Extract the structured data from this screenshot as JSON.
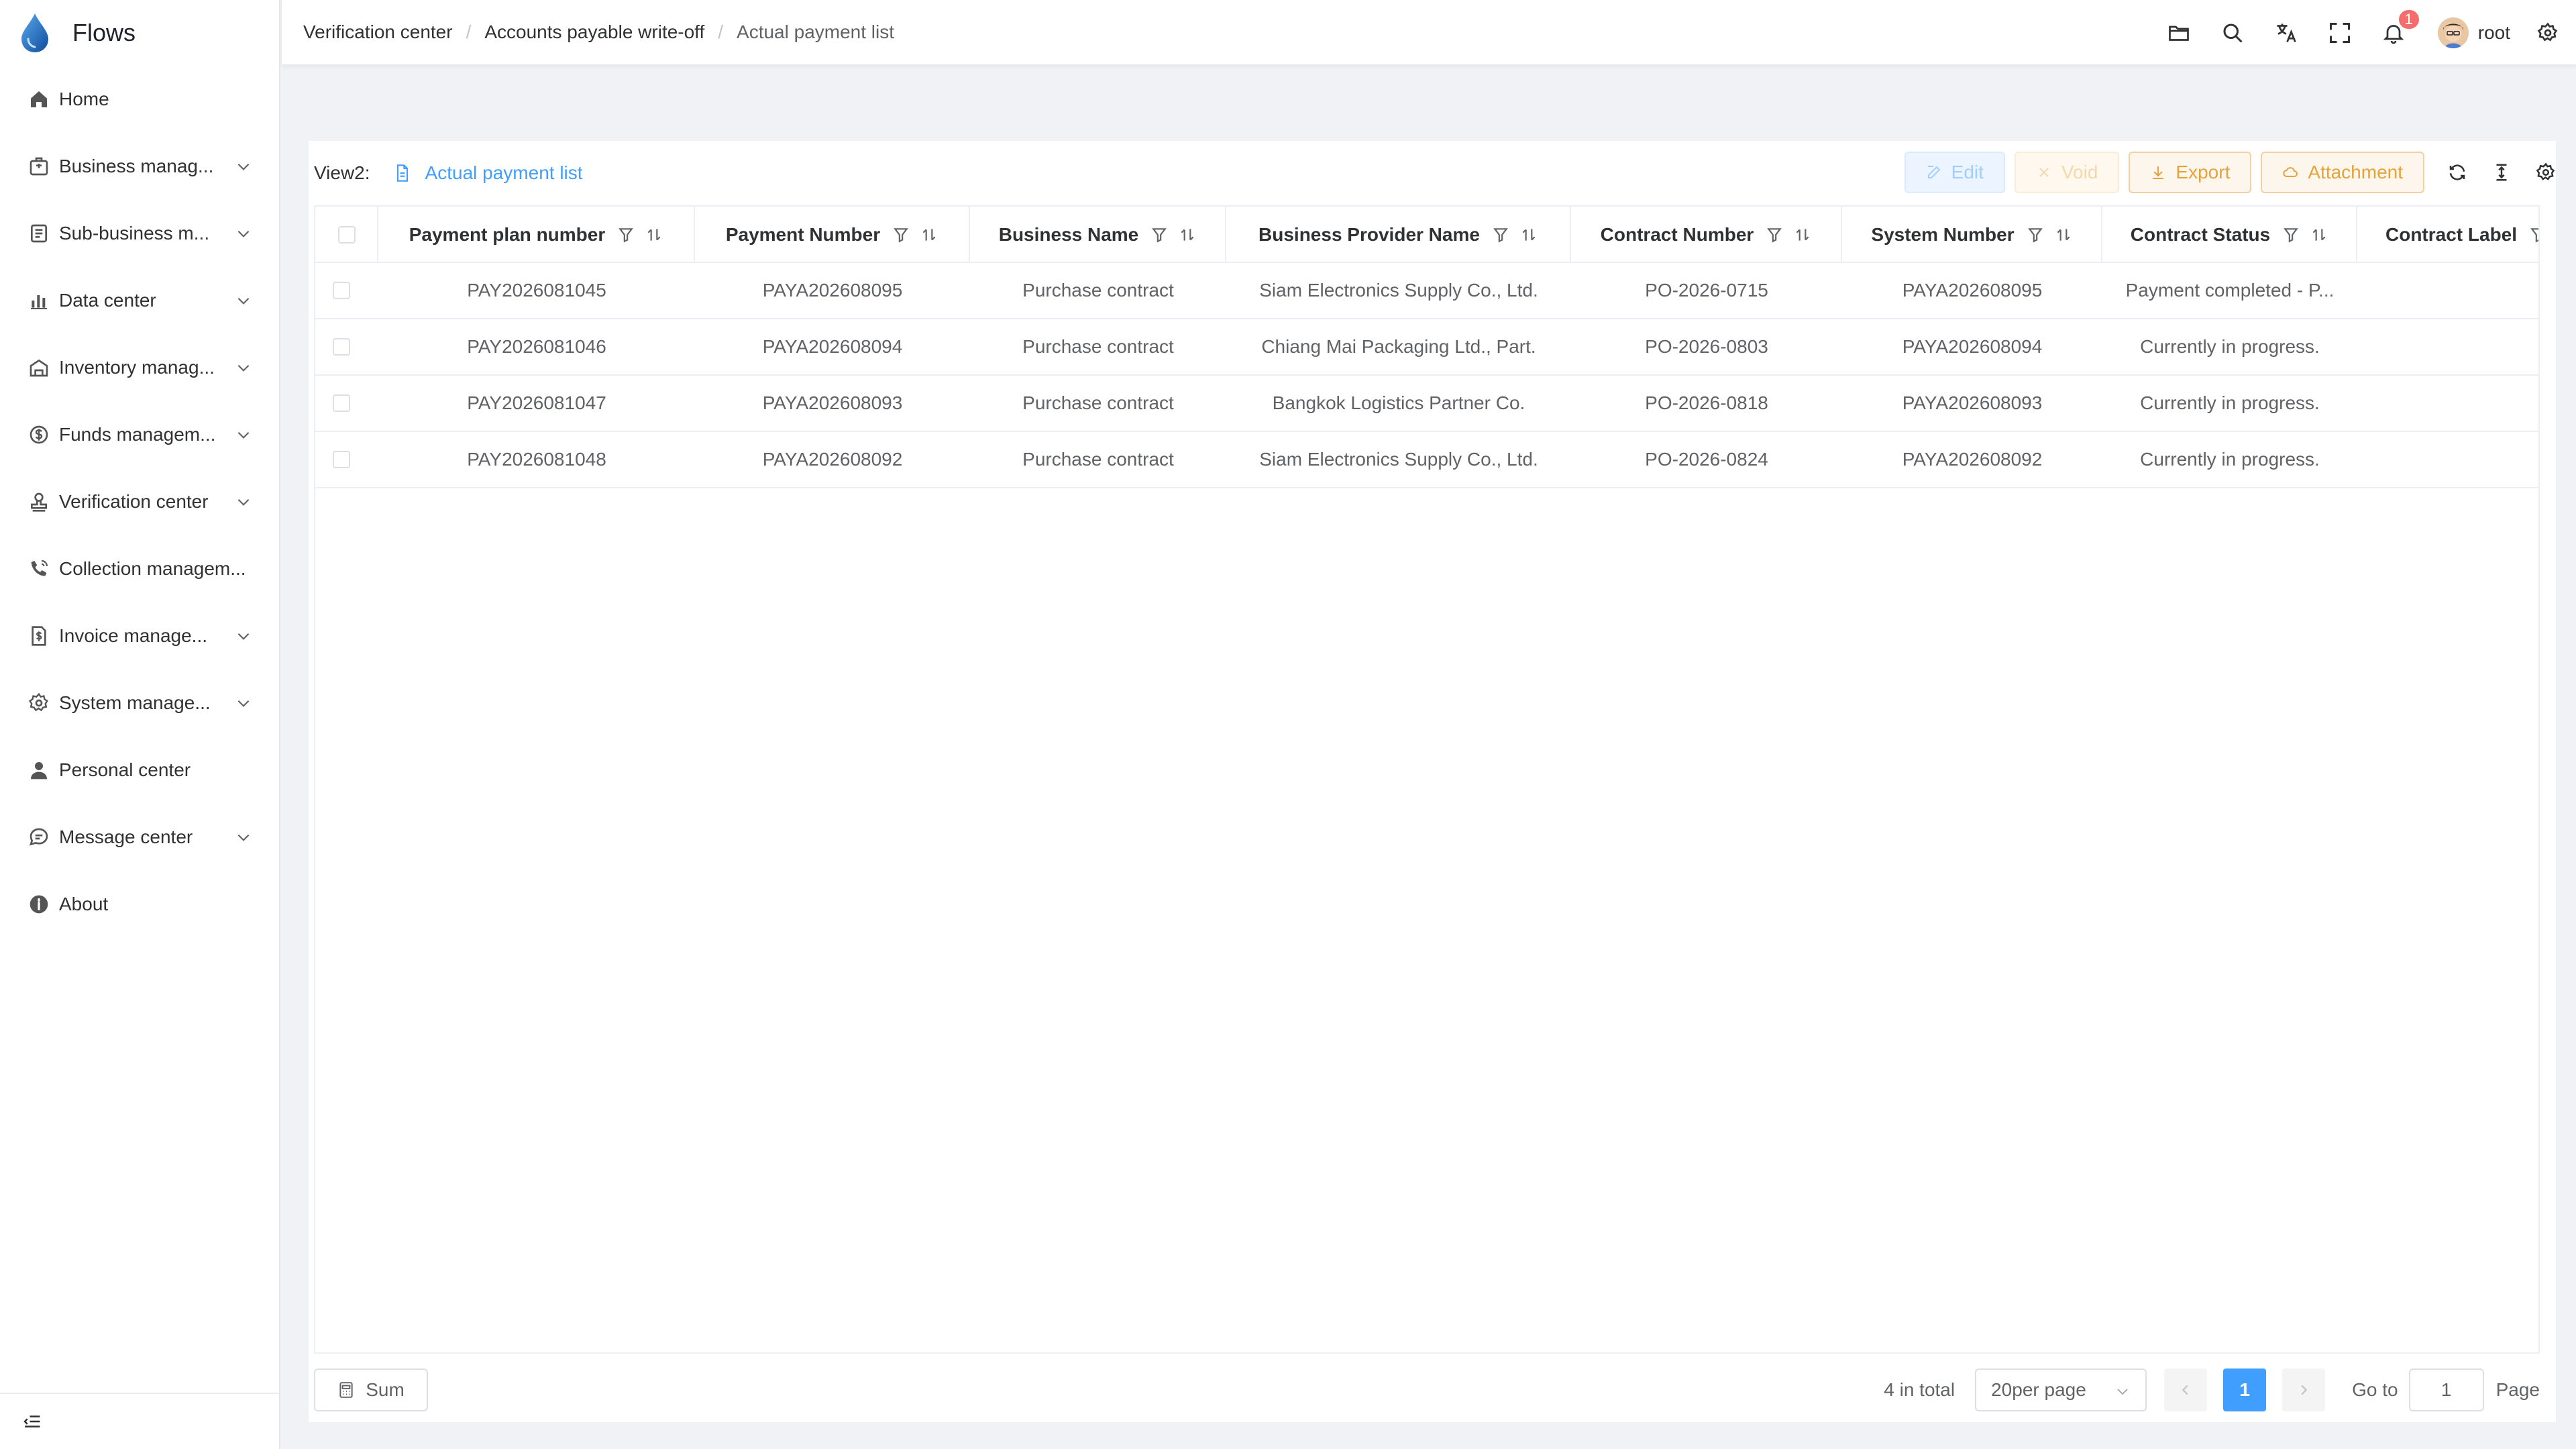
{
  "app": {
    "title": "Flows"
  },
  "sidebar": {
    "items": [
      {
        "label": "Home",
        "icon": "home-icon",
        "expandable": false
      },
      {
        "label": "Business manag...",
        "icon": "briefcase-icon",
        "expandable": true
      },
      {
        "label": "Sub-business m...",
        "icon": "clipboard-list-icon",
        "expandable": true
      },
      {
        "label": "Data center",
        "icon": "bar-chart-icon",
        "expandable": true
      },
      {
        "label": "Inventory manag...",
        "icon": "warehouse-icon",
        "expandable": true
      },
      {
        "label": "Funds managem...",
        "icon": "coin-icon",
        "expandable": true
      },
      {
        "label": "Verification center",
        "icon": "stamp-icon",
        "expandable": true
      },
      {
        "label": "Collection managem...",
        "icon": "phone-icon",
        "expandable": false
      },
      {
        "label": "Invoice manage...",
        "icon": "invoice-icon",
        "expandable": true
      },
      {
        "label": "System manage...",
        "icon": "gear-icon",
        "expandable": true
      },
      {
        "label": "Personal center",
        "icon": "user-icon",
        "expandable": false
      },
      {
        "label": "Message center",
        "icon": "chat-icon",
        "expandable": true
      },
      {
        "label": "About",
        "icon": "info-icon",
        "expandable": false
      }
    ]
  },
  "header": {
    "breadcrumb": [
      "Verification center",
      "Accounts payable write-off",
      "Actual payment list"
    ],
    "notification_count": "1",
    "username": "root"
  },
  "toolbar": {
    "view_label": "View2:",
    "view_name": "Actual payment list",
    "edit": "Edit",
    "void": "Void",
    "export": "Export",
    "attachment": "Attachment"
  },
  "table": {
    "columns": [
      "Payment plan number",
      "Payment Number",
      "Business Name",
      "Business Provider Name",
      "Contract Number",
      "System Number",
      "Contract Status",
      "Contract Label"
    ],
    "rows": [
      [
        "PAY2026081045",
        "PAYA202608095",
        "Purchase contract",
        "Siam Electronics Supply Co., Ltd.",
        "PO-2026-0715",
        "PAYA202608095",
        "Payment completed - P...",
        ""
      ],
      [
        "PAY2026081046",
        "PAYA202608094",
        "Purchase contract",
        "Chiang Mai Packaging Ltd., Part.",
        "PO-2026-0803",
        "PAYA202608094",
        "Currently in progress.",
        ""
      ],
      [
        "PAY2026081047",
        "PAYA202608093",
        "Purchase contract",
        "Bangkok Logistics Partner Co.",
        "PO-2026-0818",
        "PAYA202608093",
        "Currently in progress.",
        ""
      ],
      [
        "PAY2026081048",
        "PAYA202608092",
        "Purchase contract",
        "Siam Electronics Supply Co., Ltd.",
        "PO-2026-0824",
        "PAYA202608092",
        "Currently in progress.",
        ""
      ]
    ]
  },
  "footer": {
    "sum": "Sum",
    "total": "4 in total",
    "page_size": "20per page",
    "current_page": "1",
    "goto_label": "Go to",
    "goto_value": "1",
    "page_word": "Page"
  },
  "colors": {
    "primary": "#409eff",
    "warning": "#e6a23c",
    "danger": "#f56c6c"
  }
}
